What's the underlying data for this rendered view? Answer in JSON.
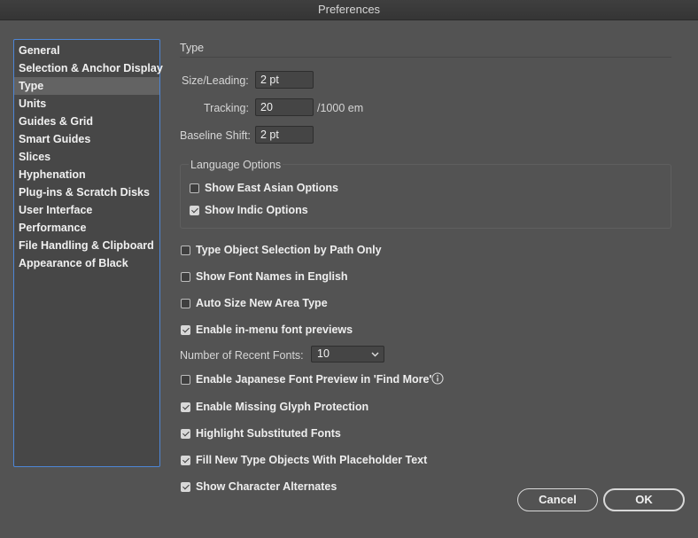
{
  "window": {
    "title": "Preferences"
  },
  "sidebar": {
    "items": [
      {
        "label": "General",
        "selected": false
      },
      {
        "label": "Selection & Anchor Display",
        "selected": false
      },
      {
        "label": "Type",
        "selected": true
      },
      {
        "label": "Units",
        "selected": false
      },
      {
        "label": "Guides & Grid",
        "selected": false
      },
      {
        "label": "Smart Guides",
        "selected": false
      },
      {
        "label": "Slices",
        "selected": false
      },
      {
        "label": "Hyphenation",
        "selected": false
      },
      {
        "label": "Plug-ins & Scratch Disks",
        "selected": false
      },
      {
        "label": "User Interface",
        "selected": false
      },
      {
        "label": "Performance",
        "selected": false
      },
      {
        "label": "File Handling & Clipboard",
        "selected": false
      },
      {
        "label": "Appearance of Black",
        "selected": false
      }
    ]
  },
  "section": {
    "title": "Type"
  },
  "fields": {
    "size_leading": {
      "label": "Size/Leading:",
      "value": "2 pt"
    },
    "tracking": {
      "label": "Tracking:",
      "value": "20",
      "unit": "/1000 em"
    },
    "baseline_shift": {
      "label": "Baseline Shift:",
      "value": "2 pt"
    }
  },
  "language_options": {
    "title": "Language Options",
    "options": [
      {
        "label": "Show East Asian Options",
        "checked": false
      },
      {
        "label": "Show Indic Options",
        "checked": true
      }
    ]
  },
  "options": [
    {
      "label": "Type Object Selection by Path Only",
      "checked": false
    },
    {
      "label": "Show Font Names in English",
      "checked": false
    },
    {
      "label": "Auto Size New Area Type",
      "checked": false
    },
    {
      "label": "Enable in-menu font previews",
      "checked": true
    }
  ],
  "recent_fonts": {
    "label": "Number of Recent Fonts:",
    "value": "10"
  },
  "options2": [
    {
      "label": "Enable Japanese Font Preview in 'Find More'",
      "checked": false
    },
    {
      "label": "Enable Missing Glyph Protection",
      "checked": true
    },
    {
      "label": "Highlight Substituted Fonts",
      "checked": true
    },
    {
      "label": "Fill New Type Objects With Placeholder Text",
      "checked": true
    },
    {
      "label": "Show Character Alternates",
      "checked": true
    }
  ],
  "buttons": {
    "cancel": "Cancel",
    "ok": "OK"
  },
  "icons": {
    "info": "info-icon",
    "dropdown": "chevron-down-icon"
  }
}
